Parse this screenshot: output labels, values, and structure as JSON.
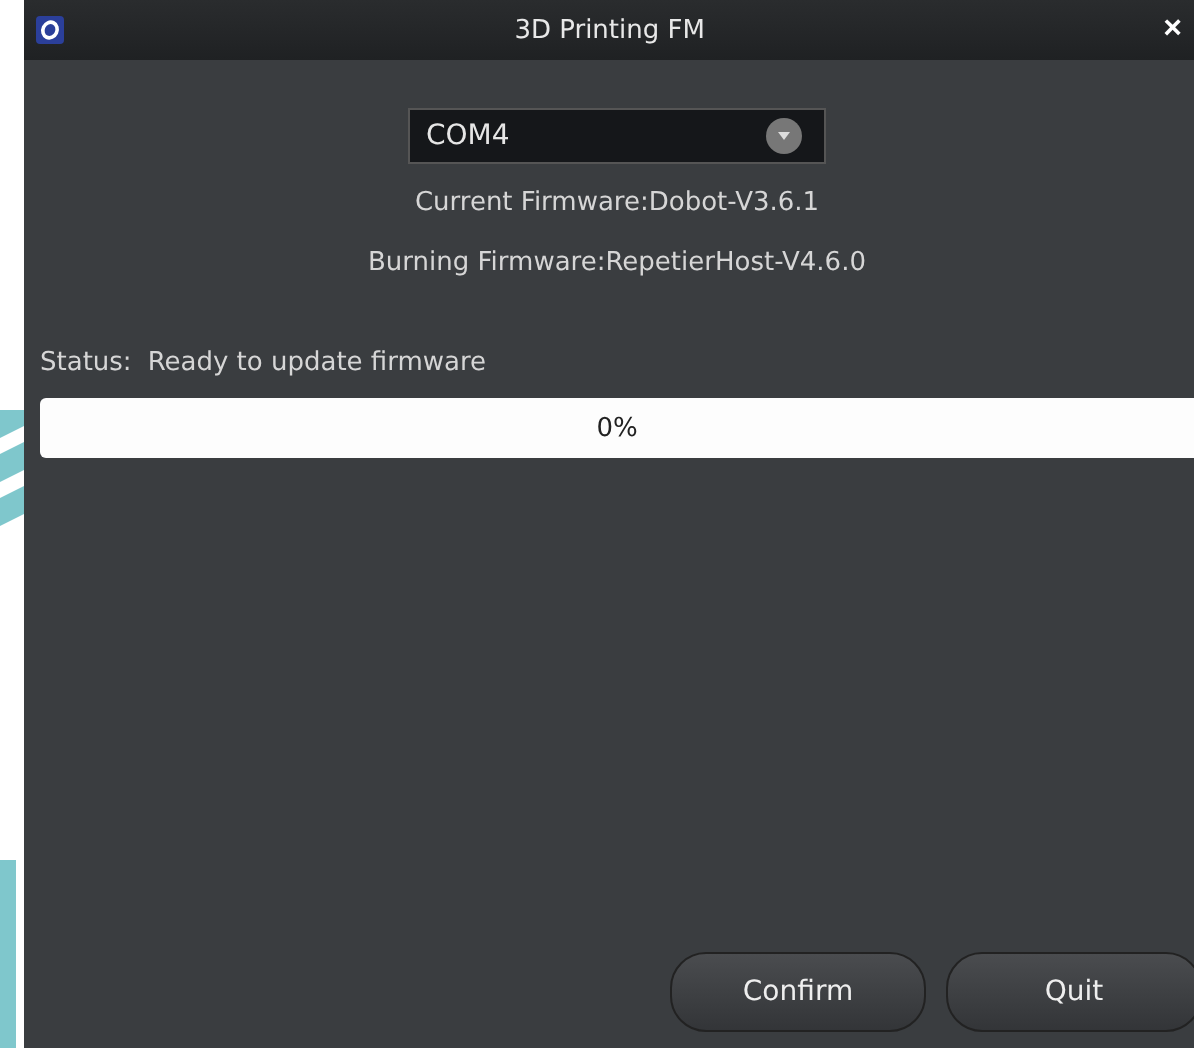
{
  "window": {
    "title": "3D Printing FM",
    "close": "×"
  },
  "port": {
    "value": "COM4"
  },
  "firmware": {
    "current": "Current Firmware:Dobot-V3.6.1",
    "burning": "Burning Firmware:RepetierHost-V4.6.0"
  },
  "status": {
    "label": "Status:",
    "text": "Ready to update firmware"
  },
  "progress": {
    "level": 0,
    "reading": "0%"
  },
  "buttons": [
    "Confirm",
    "Quit"
  ]
}
